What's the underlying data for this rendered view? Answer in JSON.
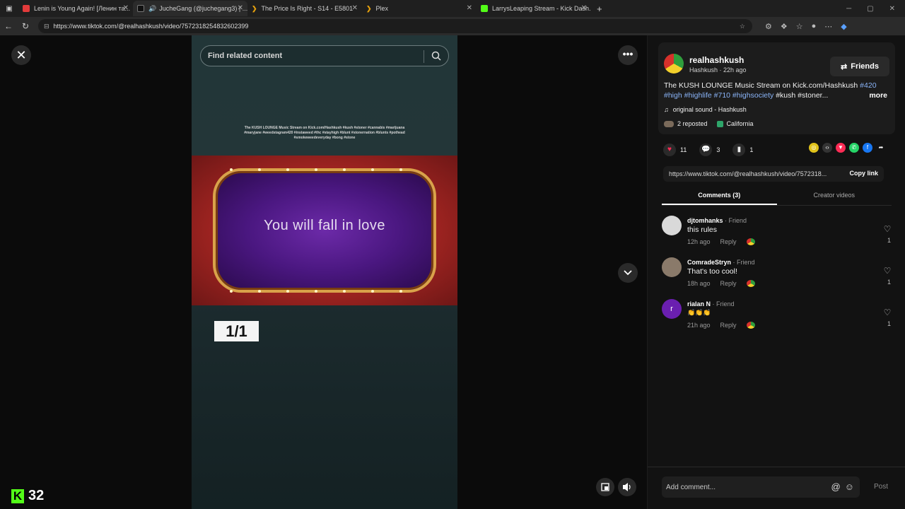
{
  "browser": {
    "tabs": [
      {
        "title": "Lenin is Young Again! [Ленин та...",
        "color": "#e23b3b"
      },
      {
        "title": "JucheGang (@juchegang3) | ...",
        "color": "#111111"
      },
      {
        "title": "The Price Is Right - S14 - E5801",
        "color": "#e5a00d"
      },
      {
        "title": "Plex",
        "color": "#e5a00d"
      },
      {
        "title": "LarrysLeaping Stream - Kick Dash...",
        "color": "#53fc18"
      }
    ],
    "url": "https://www.tiktok.com/@realhashkush/video/7572318254832602399"
  },
  "video": {
    "search_placeholder": "Find related content",
    "caption": "The KUSH LOUNGE Music Stream on Kick.com/Hashkush #kush #stoner #cannabis #marijuana #maryjane #weedstagram420 #instaweed #thc #stayhigh #blunt #stonernation #blunts #pothead #smokeweedeveryday #bong #stone",
    "banner_text": "You will fall in love",
    "counter": "1/1"
  },
  "kick": {
    "count": "32"
  },
  "post": {
    "username": "realhashkush",
    "handle": "Hashkush · 22h ago",
    "friends_label": "Friends",
    "desc_plain": "The KUSH LOUNGE Music Stream on Kick.com/Hashkush ",
    "desc_tag1": "#420",
    "desc_tags_line2": "#high #highlife #710 #highsociety",
    "desc_rest": " #kush #stoner...",
    "more": "more",
    "sound": "original sound - Hashkush",
    "reposted": "2 reposted",
    "location": "California",
    "likes": "11",
    "comments": "3",
    "saves": "1",
    "link": "https://www.tiktok.com/@realhashkush/video/7572318...",
    "copy_link": "Copy link"
  },
  "tabs": {
    "comments": "Comments (3)",
    "creator": "Creator videos"
  },
  "comments": [
    {
      "user": "djtomhanks",
      "tag": " · Friend",
      "text": "this rules",
      "time": "12h ago",
      "reply": "Reply",
      "likes": "1",
      "avatar_color": "#d9d9d9"
    },
    {
      "user": "ComradeStryn",
      "tag": " · Friend",
      "text": "That's too cool!",
      "time": "18h ago",
      "reply": "Reply",
      "likes": "1",
      "avatar_color": "#8a7a6a"
    },
    {
      "user": "rialan N",
      "tag": " · Friend",
      "text": "👏👏👏",
      "time": "21h ago",
      "reply": "Reply",
      "likes": "1",
      "avatar_color": "#6a1fb0",
      "initial": "r"
    }
  ],
  "add_comment": {
    "placeholder": "Add comment...",
    "post": "Post"
  }
}
